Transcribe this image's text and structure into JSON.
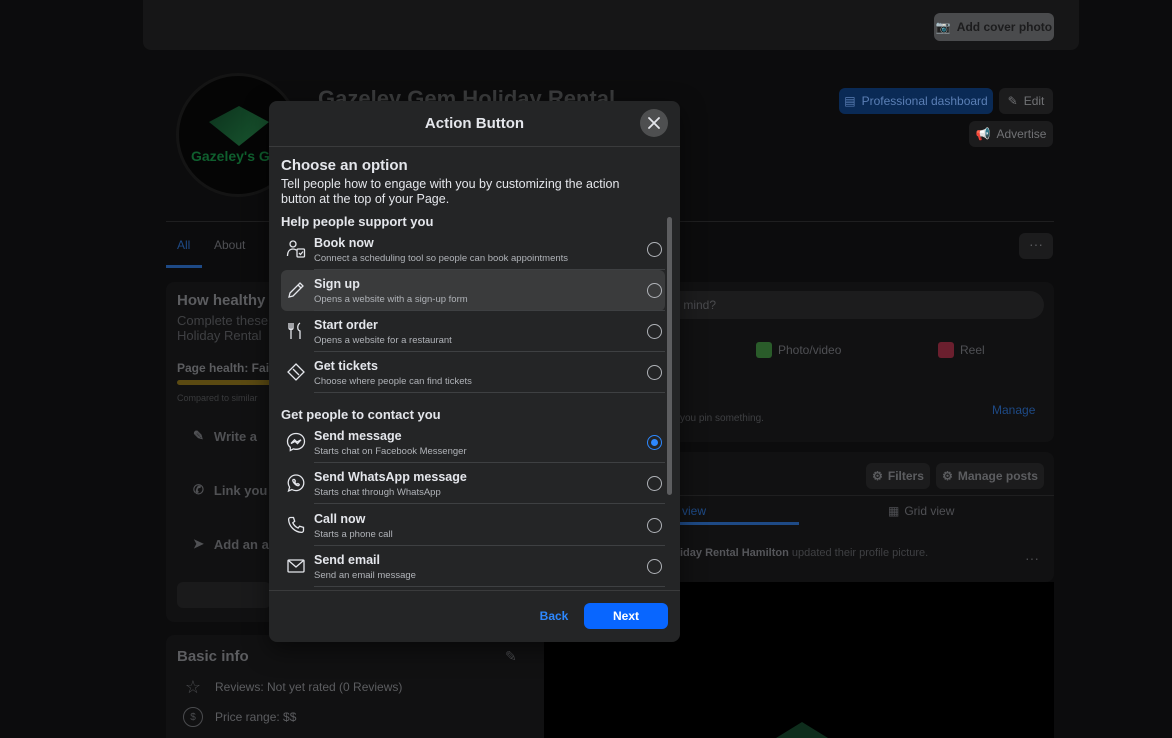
{
  "background": {
    "add_cover_photo": "Add cover photo",
    "logo_text": "Gazeley's G",
    "page_name": "Gazeley Gem Holiday Rental",
    "professional_dashboard": "Professional dashboard",
    "edit": "Edit",
    "advertise": "Advertise",
    "tabs": [
      "All",
      "About"
    ],
    "more": "···",
    "health_title": "How healthy",
    "health_sub": "Complete these Holiday Rental",
    "page_health": "Page health: Fair",
    "compared": "Compared to similar",
    "left_items": [
      "Write a",
      "Link you",
      "Add an a"
    ],
    "basic_info": "Basic info",
    "reviews": "Reviews: Not yet rated (0 Reviews)",
    "price_range": "Price range: $$",
    "mind_placeholder": "r mind?",
    "photo_video": "Photo/video",
    "reel": "Reel",
    "pinned": "you pin something.",
    "manage": "Manage",
    "filters": "Filters",
    "manage_posts": "Manage posts",
    "list_view": "view",
    "grid_view": "Grid view",
    "updated_name": "iday Rental Hamilton",
    "updated_text": " updated their profile picture.",
    "post_more": "···"
  },
  "modal": {
    "title": "Action Button",
    "choose": "Choose an option",
    "description": "Tell people how to engage with you by customizing the action button at the top of your Page.",
    "sections": [
      {
        "title": "Help people support you",
        "options": [
          {
            "label": "Book now",
            "sub": "Connect a scheduling tool so people can book appointments",
            "icon": "calendar-person-icon",
            "selected": false
          },
          {
            "label": "Sign up",
            "sub": "Opens a website with a sign-up form",
            "icon": "pencil-icon",
            "selected": false
          },
          {
            "label": "Start order",
            "sub": "Opens a website for a restaurant",
            "icon": "fork-knife-icon",
            "selected": false
          },
          {
            "label": "Get tickets",
            "sub": "Choose where people can find tickets",
            "icon": "ticket-icon",
            "selected": false
          }
        ]
      },
      {
        "title": "Get people to contact you",
        "options": [
          {
            "label": "Send message",
            "sub": "Starts chat on Facebook Messenger",
            "icon": "messenger-icon",
            "selected": true
          },
          {
            "label": "Send WhatsApp message",
            "sub": "Starts chat through WhatsApp",
            "icon": "whatsapp-icon",
            "selected": false
          },
          {
            "label": "Call now",
            "sub": "Starts a phone call",
            "icon": "phone-icon",
            "selected": false
          },
          {
            "label": "Send email",
            "sub": "Send an email message",
            "icon": "envelope-icon",
            "selected": false
          }
        ]
      }
    ],
    "back": "Back",
    "next": "Next"
  },
  "colors": {
    "accent": "#0866ff",
    "radio_selected": "#2d88ff",
    "modal_bg": "#242526"
  }
}
